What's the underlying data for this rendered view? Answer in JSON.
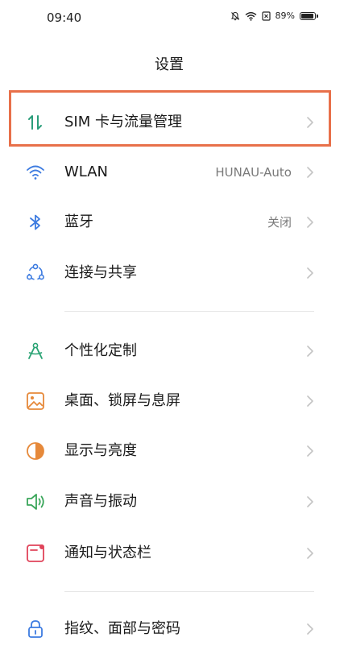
{
  "status_bar": {
    "time": "09:40",
    "battery_level": "89%",
    "icons": [
      "mute-bell-icon",
      "wifi-icon",
      "sim-icon",
      "battery-icon"
    ]
  },
  "page_title": "设置",
  "settings": [
    {
      "label": "SIM 卡与流量管理",
      "value": "",
      "icon": "data-arrows-icon",
      "highlighted": true
    },
    {
      "label": "WLAN",
      "value": "HUNAU-Auto",
      "icon": "wifi-icon"
    },
    {
      "label": "蓝牙",
      "value": "关闭",
      "icon": "bluetooth-icon"
    },
    {
      "label": "连接与共享",
      "value": "",
      "icon": "share-nodes-icon"
    },
    {
      "label": "个性化定制",
      "value": "",
      "icon": "compass-icon"
    },
    {
      "label": "桌面、锁屏与息屏",
      "value": "",
      "icon": "wallpaper-icon"
    },
    {
      "label": "显示与亮度",
      "value": "",
      "icon": "brightness-icon"
    },
    {
      "label": "声音与振动",
      "value": "",
      "icon": "speaker-icon"
    },
    {
      "label": "通知与状态栏",
      "value": "",
      "icon": "notification-icon"
    },
    {
      "label": "指纹、面部与密码",
      "value": "",
      "icon": "lock-icon"
    }
  ],
  "colors": {
    "highlight_border": "#e8704a",
    "chevron": "#c4c4c4",
    "value_text": "#7a7a7a"
  }
}
